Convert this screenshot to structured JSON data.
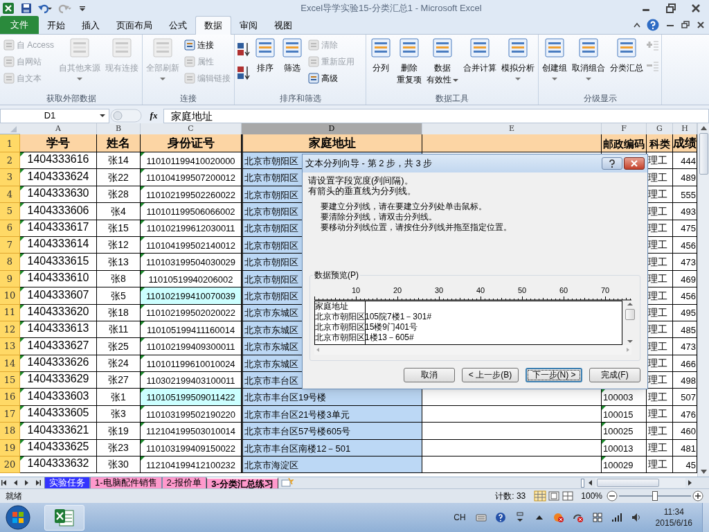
{
  "window": {
    "title": "Excel导学实验15-分类汇总1  -  Microsoft Excel"
  },
  "ribbon_tabs": [
    {
      "label": "文件",
      "selected": false,
      "kind": "file"
    },
    {
      "label": "开始",
      "selected": false,
      "kind": "tab"
    },
    {
      "label": "插入",
      "selected": false,
      "kind": "tab"
    },
    {
      "label": "页面布局",
      "selected": false,
      "kind": "tab"
    },
    {
      "label": "公式",
      "selected": false,
      "kind": "tab"
    },
    {
      "label": "数据",
      "selected": true,
      "kind": "tab"
    },
    {
      "label": "审阅",
      "selected": false,
      "kind": "tab"
    },
    {
      "label": "视图",
      "selected": false,
      "kind": "tab"
    }
  ],
  "ribbon_groups": [
    {
      "title": "获取外部数据",
      "items": [
        {
          "kind": "small",
          "label": "自 Access",
          "disabled": true
        },
        {
          "kind": "small",
          "label": "自网站",
          "disabled": true
        },
        {
          "kind": "small",
          "label": "自文本",
          "disabled": true
        },
        {
          "kind": "large",
          "lines": [
            "自其他来源"
          ],
          "disabled": true,
          "dropdown": true
        },
        {
          "kind": "large",
          "lines": [
            "现有连接"
          ],
          "disabled": true,
          "dropdown": false
        }
      ]
    },
    {
      "title": "连接",
      "items": [
        {
          "kind": "large",
          "lines": [
            "全部刷新"
          ],
          "disabled": true,
          "dropdown": true
        },
        {
          "kind": "small",
          "label": "连接",
          "disabled": false
        },
        {
          "kind": "small",
          "label": "属性",
          "disabled": true
        },
        {
          "kind": "small",
          "label": "编辑链接",
          "disabled": true
        }
      ]
    },
    {
      "title": "排序和筛选",
      "items": [
        {
          "kind": "sort",
          "disabled": false
        },
        {
          "kind": "large",
          "lines": [
            "排序"
          ],
          "disabled": false,
          "dropdown": false
        },
        {
          "kind": "large",
          "lines": [
            "筛选"
          ],
          "disabled": false,
          "dropdown": false
        },
        {
          "kind": "small",
          "label": "清除",
          "disabled": true
        },
        {
          "kind": "small",
          "label": "重新应用",
          "disabled": true
        },
        {
          "kind": "small",
          "label": "高级",
          "disabled": false
        }
      ]
    },
    {
      "title": "数据工具",
      "items": [
        {
          "kind": "large",
          "lines": [
            "分列"
          ],
          "disabled": false,
          "dropdown": false
        },
        {
          "kind": "large",
          "lines": [
            "删除",
            "重复项"
          ],
          "disabled": false,
          "dropdown": false
        },
        {
          "kind": "large",
          "lines": [
            "数据",
            "有效性"
          ],
          "disabled": false,
          "dropdown": true
        },
        {
          "kind": "large",
          "lines": [
            "合并计算"
          ],
          "disabled": false,
          "dropdown": false
        },
        {
          "kind": "large",
          "lines": [
            "模拟分析"
          ],
          "disabled": false,
          "dropdown": true
        }
      ]
    },
    {
      "title": "分级显示",
      "items": [
        {
          "kind": "large",
          "lines": [
            "创建组"
          ],
          "disabled": false,
          "dropdown": true
        },
        {
          "kind": "large",
          "lines": [
            "取消组合"
          ],
          "disabled": false,
          "dropdown": true
        },
        {
          "kind": "large",
          "lines": [
            "分类汇总"
          ],
          "disabled": false,
          "dropdown": false
        },
        {
          "kind": "detail",
          "disabled": true
        }
      ]
    }
  ],
  "formula_bar": {
    "name_box": "D1",
    "fx_label": "fx",
    "formula": "家庭地址"
  },
  "columns": [
    {
      "label": "A",
      "selected": false
    },
    {
      "label": "B",
      "selected": false
    },
    {
      "label": "C",
      "selected": false
    },
    {
      "label": "D",
      "selected": true
    },
    {
      "label": "E",
      "selected": false
    },
    {
      "label": "F",
      "selected": false
    },
    {
      "label": "G",
      "selected": false
    },
    {
      "label": "H",
      "selected": false
    }
  ],
  "header_row": {
    "number": "1",
    "cells": [
      "学号",
      "姓名",
      "身份证号",
      "家庭地址",
      "",
      "邮政编码",
      "科类",
      "成绩"
    ]
  },
  "rows": [
    {
      "number": "2",
      "id": "1404333616",
      "name": "张14",
      "id_card": "110101199410020000",
      "id_highlight": false,
      "address": "北京市朝阳区",
      "category": "理工",
      "score": "444"
    },
    {
      "number": "3",
      "id": "1404333624",
      "name": "张22",
      "id_card": "110104199507200012",
      "id_highlight": false,
      "address": "北京市朝阳区",
      "category": "理工",
      "score": "489"
    },
    {
      "number": "4",
      "id": "1404333630",
      "name": "张28",
      "id_card": "110102199502260022",
      "id_highlight": false,
      "address": "北京市朝阳区",
      "category": "理工",
      "score": "555"
    },
    {
      "number": "5",
      "id": "1404333606",
      "name": "张4",
      "id_card": "110101199506066002",
      "id_highlight": false,
      "address": "北京市朝阳区",
      "category": "理工",
      "score": "493"
    },
    {
      "number": "6",
      "id": "1404333617",
      "name": "张15",
      "id_card": "110102199612030011",
      "id_highlight": false,
      "address": "北京市朝阳区",
      "category": "理工",
      "score": "475"
    },
    {
      "number": "7",
      "id": "1404333614",
      "name": "张12",
      "id_card": "110104199502140012",
      "id_highlight": false,
      "address": "北京市朝阳区",
      "category": "理工",
      "score": "456"
    },
    {
      "number": "8",
      "id": "1404333615",
      "name": "张13",
      "id_card": "110103199504030029",
      "id_highlight": false,
      "address": "北京市朝阳区",
      "category": "理工",
      "score": "473"
    },
    {
      "number": "9",
      "id": "1404333610",
      "name": "张8",
      "id_card": "11010519940206002",
      "id_highlight": false,
      "address": "北京市朝阳区",
      "category": "理工",
      "score": "469"
    },
    {
      "number": "10",
      "id": "1404333607",
      "name": "张5",
      "id_card": "110102199410070039",
      "id_highlight": true,
      "address": "北京市朝阳区",
      "category": "理工",
      "score": "456"
    },
    {
      "number": "11",
      "id": "1404333620",
      "name": "张18",
      "id_card": "110102199502020022",
      "id_highlight": false,
      "address": "北京市东城区",
      "category": "理工",
      "score": "495"
    },
    {
      "number": "12",
      "id": "1404333613",
      "name": "张11",
      "id_card": "110105199411160014",
      "id_highlight": false,
      "address": "北京市东城区",
      "category": "理工",
      "score": "485"
    },
    {
      "number": "13",
      "id": "1404333627",
      "name": "张25",
      "id_card": "110102199409300011",
      "id_highlight": false,
      "address": "北京市东城区",
      "category": "理工",
      "score": "473"
    },
    {
      "number": "14",
      "id": "1404333626",
      "name": "张24",
      "id_card": "110101199610010024",
      "id_highlight": false,
      "address": "北京市东城区",
      "category": "理工",
      "score": "466"
    },
    {
      "number": "15",
      "id": "1404333629",
      "name": "张27",
      "id_card": "110302199403100011",
      "id_highlight": false,
      "address": "北京市丰台区",
      "category": "理工",
      "score": "498"
    },
    {
      "number": "16",
      "id": "1404333603",
      "name": "张1",
      "id_card": "110105199509011422",
      "id_highlight": true,
      "address": "北京市丰台区19号楼",
      "postcode": "100003",
      "category": "理工",
      "score": "507"
    },
    {
      "number": "17",
      "id": "1404333605",
      "name": "张3",
      "id_card": "110103199502190220",
      "id_highlight": false,
      "address": "北京市丰台区21号楼3单元",
      "postcode": "100015",
      "category": "理工",
      "score": "476"
    },
    {
      "number": "18",
      "id": "1404333621",
      "name": "张19",
      "id_card": "112104199503010014",
      "id_highlight": false,
      "address": "北京市丰台区57号楼605号",
      "postcode": "100025",
      "category": "理工",
      "score": "460"
    },
    {
      "number": "19",
      "id": "1404333625",
      "name": "张23",
      "id_card": "110103199409150022",
      "id_highlight": false,
      "address": "北京市丰台区南楼12－501",
      "postcode": "100013",
      "category": "理工",
      "score": "481"
    },
    {
      "number": "20",
      "id": "1404333632",
      "name": "张30",
      "id_card": "112104199412100232",
      "id_highlight": false,
      "address": "北京市海淀区",
      "postcode": "100029",
      "category": "理工",
      "score": "45"
    }
  ],
  "dialog": {
    "title": "文本分列向导 - 第 2 步，共 3 步",
    "intro": [
      "请设置字段宽度(列间隔)。",
      "有箭头的垂直线为分列线。"
    ],
    "instructions": [
      "要建立分列线，请在要建立分列处单击鼠标。",
      "要清除分列线，请双击分列线。",
      "要移动分列线位置，请按住分列线并拖至指定位置。"
    ],
    "preview_label": "数据预览(P)",
    "ruler": [
      "10",
      "20",
      "30",
      "40",
      "50",
      "60",
      "70"
    ],
    "preview_lines": [
      "家庭地址",
      "北京市朝阳区105院7楼1－301#",
      "北京市朝阳区15楼9门401号",
      "北京市朝阳区1楼13－605#"
    ],
    "buttons": [
      {
        "label": "取消",
        "focused": false
      },
      {
        "label": "< 上一步(B)",
        "focused": false
      },
      {
        "label": "下一步(N) >",
        "focused": true
      },
      {
        "label": "完成(F)",
        "focused": false
      }
    ]
  },
  "sheet_tabs": [
    {
      "label": "实验任务",
      "selected": false,
      "color": "#3333ff"
    },
    {
      "label": "1-电脑配件销售",
      "selected": false,
      "color": "#ff99cc"
    },
    {
      "label": "2-报价单",
      "selected": false,
      "color": "#ff99cc"
    },
    {
      "label": "3-分类汇总练习",
      "selected": true,
      "color": "#ff99cc"
    }
  ],
  "status_bar": {
    "ready": "就绪",
    "count": "计数: 33",
    "zoom": "100%"
  },
  "taskbar": {
    "language": "CH",
    "time": "11:34",
    "date": "2015/6/16"
  }
}
